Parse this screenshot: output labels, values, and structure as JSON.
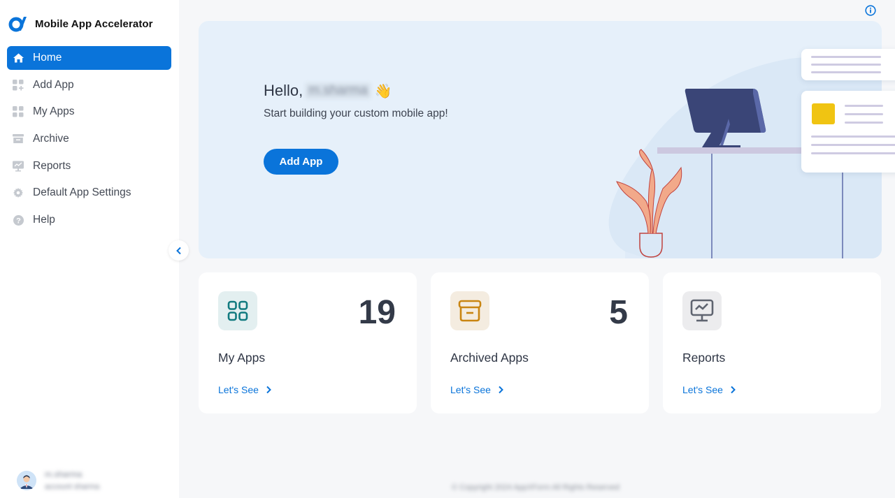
{
  "app": {
    "title": "Mobile App Accelerator",
    "brand_color": "#0a74da"
  },
  "sidebar": {
    "items": [
      {
        "label": "Home",
        "icon": "home-icon",
        "active": true
      },
      {
        "label": "Add App",
        "icon": "add-app-icon",
        "active": false
      },
      {
        "label": "My Apps",
        "icon": "grid-icon",
        "active": false
      },
      {
        "label": "Archive",
        "icon": "archive-icon",
        "active": false
      },
      {
        "label": "Reports",
        "icon": "reports-icon",
        "active": false
      },
      {
        "label": "Default App Settings",
        "icon": "gear-icon",
        "active": false
      },
      {
        "label": "Help",
        "icon": "help-icon",
        "active": false
      }
    ],
    "collapse_icon": "chevron-left-icon",
    "user": {
      "name": "m.sharma",
      "subtitle": "account sharma"
    }
  },
  "hero": {
    "greeting": "Hello,",
    "user_name": "m.sharma",
    "wave_emoji": "👋",
    "subtitle": "Start building your custom mobile app!",
    "button_label": "Add App"
  },
  "cards": [
    {
      "title": "My Apps",
      "count": "19",
      "link": "Let's See",
      "icon": "grid-icon",
      "icon_bg": "#e3eff0",
      "icon_color": "#117a7f"
    },
    {
      "title": "Archived Apps",
      "count": "5",
      "link": "Let's See",
      "icon": "archive-icon",
      "icon_bg": "#f4ece0",
      "icon_color": "#c98512"
    },
    {
      "title": "Reports",
      "count": "",
      "link": "Let's See",
      "icon": "reports-icon",
      "icon_bg": "#ececee",
      "icon_color": "#5f6470"
    }
  ],
  "footer": {
    "copyright": "© Copyright 2024 AppXForm All Rights Reserved"
  }
}
